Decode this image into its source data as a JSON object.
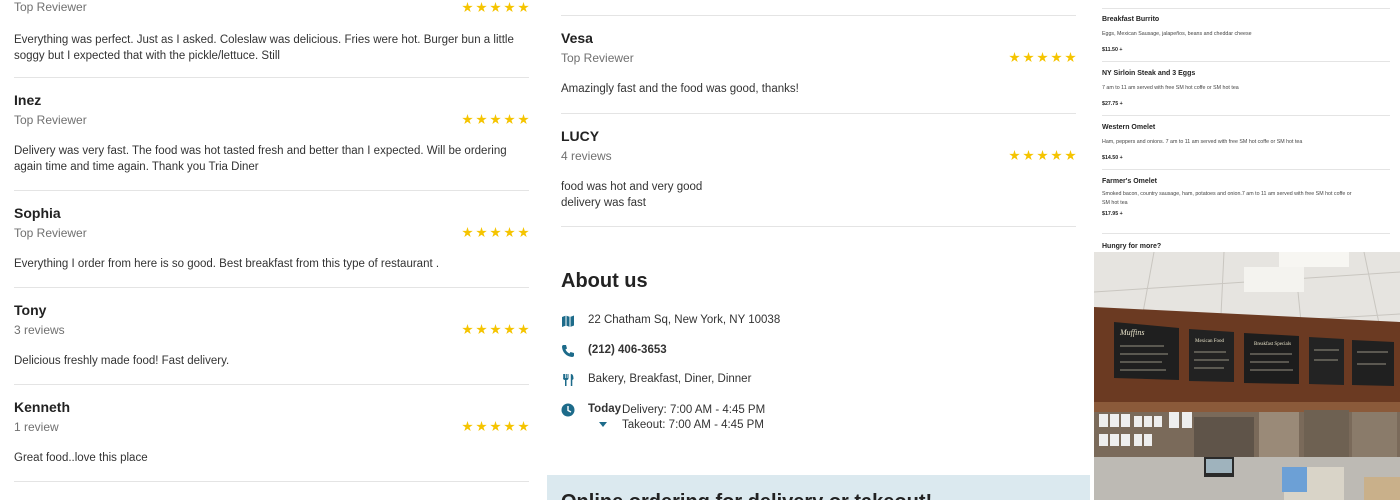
{
  "reviews_left": [
    {
      "name": "",
      "subtitle": "Top Reviewer",
      "rating": 5,
      "text": "Everything was perfect. Just as I asked. Coleslaw was delicious. Fries were hot. Burger bun a little soggy but I expected that with the pickle/lettuce. Still"
    },
    {
      "name": "Inez",
      "subtitle": "Top Reviewer",
      "rating": 5,
      "text": "Delivery was very fast. The food was hot tasted fresh and better than I expected. Will be ordering again time and time again. Thank you Tria Diner"
    },
    {
      "name": "Sophia",
      "subtitle": "Top Reviewer",
      "rating": 5,
      "text": "Everything I order from here is so good. Best breakfast from this type of restaurant ."
    },
    {
      "name": "Tony",
      "subtitle": "3 reviews",
      "rating": 5,
      "text": "Delicious freshly made food! Fast delivery."
    },
    {
      "name": "Kenneth",
      "subtitle": "1 review",
      "rating": 5,
      "text": "Great food..love this place"
    }
  ],
  "reviews_mid": [
    {
      "name": "Vesa",
      "subtitle": "Top Reviewer",
      "rating": 5,
      "text": "Amazingly fast and the food was good, thanks!"
    },
    {
      "name": "LUCY",
      "subtitle": "4 reviews",
      "rating": 5,
      "text_lines": [
        "food was hot and very good",
        "delivery was fast"
      ]
    }
  ],
  "about": {
    "title": "About us",
    "address": "22 Chatham Sq, New York, NY 10038",
    "phone": "(212) 406-3653",
    "categories": "Bakery, Breakfast, Diner, Dinner",
    "hours_today_label": "Today",
    "hours_delivery": "Delivery: 7:00 AM - 4:45 PM",
    "hours_takeout": "Takeout: 7:00 AM - 4:45 PM"
  },
  "order_banner": "Online ordering for delivery or takeout!",
  "menu": {
    "items": [
      {
        "name": "Breakfast Burrito",
        "desc": "Eggs, Mexican Sausage, jalapeños, beans and cheddar cheese",
        "price": "$11.50 +"
      },
      {
        "name": "NY Sirloin Steak and 3 Eggs",
        "desc": "7 am to 11 am served with free SM hot coffe or SM hot tea",
        "price": "$27.75 +"
      },
      {
        "name": "Western Omelet",
        "desc": "Ham, peppers and onions. 7 am to 11 am served with free SM hot coffe or SM hot tea",
        "price": "$14.50 +"
      },
      {
        "name": "Farmer's Omelet",
        "desc": "Smoked bacon, country sausage, ham, potatoes and onion.7 am to 11 am served with free SM hot coffe or SM hot tea",
        "price": "$17.95 +"
      }
    ],
    "more": "Hungry for more?"
  },
  "photo_signs": {
    "muffins": "Muffins",
    "mexican": "Mexican Food",
    "breakfast": "Breakfast Specials"
  },
  "colors": {
    "star": "#f5c400",
    "icon": "#1d6b8a",
    "banner": "#dbe9ef"
  }
}
